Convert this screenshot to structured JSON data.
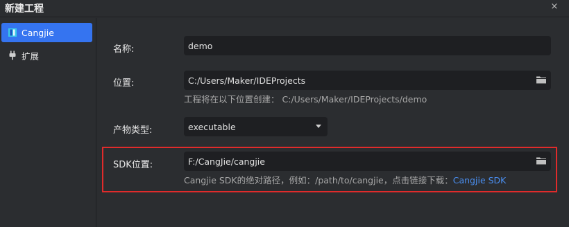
{
  "window": {
    "title": "新建工程",
    "close_glyph": "×"
  },
  "sidebar": {
    "items": [
      {
        "label": "Cangjie",
        "icon": "cangjie-logo-icon",
        "active": true
      },
      {
        "label": "扩展",
        "icon": "plug-icon",
        "active": false
      }
    ]
  },
  "form": {
    "name": {
      "label": "名称:",
      "value": "demo"
    },
    "location": {
      "label": "位置:",
      "value": "C:/Users/Maker/IDEProjects",
      "hint_prefix": "工程将在以下位置创建：",
      "hint_path": "C:/Users/Maker/IDEProjects/demo"
    },
    "artifact": {
      "label": "产物类型:",
      "value": "executable"
    },
    "sdk": {
      "label": "SDK位置:",
      "value": "F:/CangJie/cangjie",
      "hint_text": "Cangjie SDK的绝对路径，例如：/path/to/cangjie，点击链接下载：",
      "hint_link": "Cangjie SDK"
    }
  },
  "colors": {
    "accent": "#3574f0",
    "highlight_border": "#e02b2b",
    "link": "#4a8ef0"
  }
}
